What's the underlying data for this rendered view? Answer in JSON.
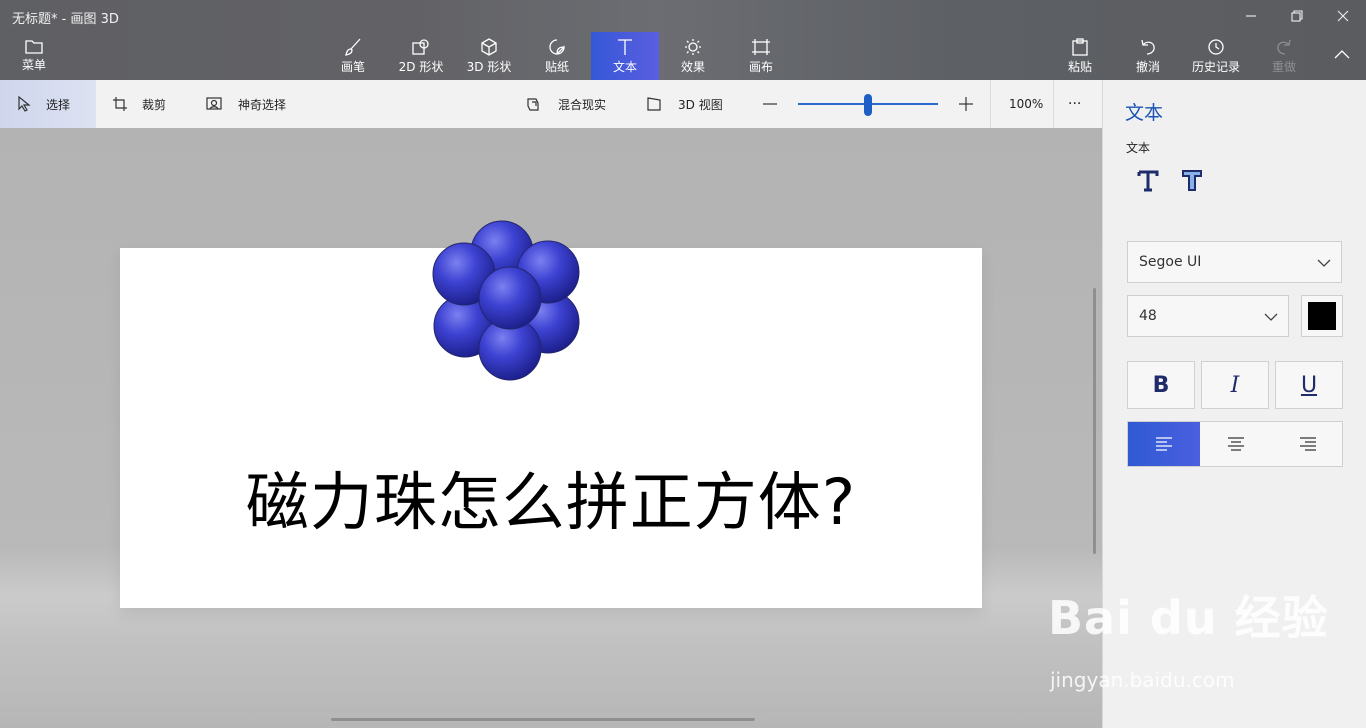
{
  "window": {
    "title": "无标题* - 画图 3D"
  },
  "ribbon": {
    "menu_label": "菜单",
    "tools": [
      {
        "label": "画笔",
        "icon": "brush-icon"
      },
      {
        "label": "2D 形状",
        "icon": "2d-shapes-icon"
      },
      {
        "label": "3D 形状",
        "icon": "3d-shapes-icon"
      },
      {
        "label": "贴纸",
        "icon": "stickers-icon"
      },
      {
        "label": "文本",
        "icon": "text-icon",
        "active": true
      },
      {
        "label": "效果",
        "icon": "effects-icon"
      },
      {
        "label": "画布",
        "icon": "canvas-icon"
      }
    ],
    "paste_label": "粘贴",
    "undo_label": "撤消",
    "history_label": "历史记录",
    "redo_label": "重做"
  },
  "toolbar": {
    "select_label": "选择",
    "crop_label": "裁剪",
    "magic_select_label": "神奇选择",
    "mixed_reality_label": "混合现实",
    "view3d_label": "3D 视图",
    "zoom_value": "100%",
    "zoom_level": 0.5,
    "more_label": "···"
  },
  "canvas": {
    "text": "磁力珠怎么拼正方体?"
  },
  "panel": {
    "title": "文本",
    "subtitle": "文本",
    "font_family": "Segoe UI",
    "font_size": "48",
    "text_color": "#000000",
    "bold_label": "B",
    "italic_label": "I",
    "underline_label": "U",
    "alignment": "left"
  },
  "watermark": {
    "main": "Bai du 经验",
    "sub": "jingyan.baidu.com"
  },
  "colors": {
    "accent": "#2f5ad4",
    "bead": "#3a3fcf"
  }
}
